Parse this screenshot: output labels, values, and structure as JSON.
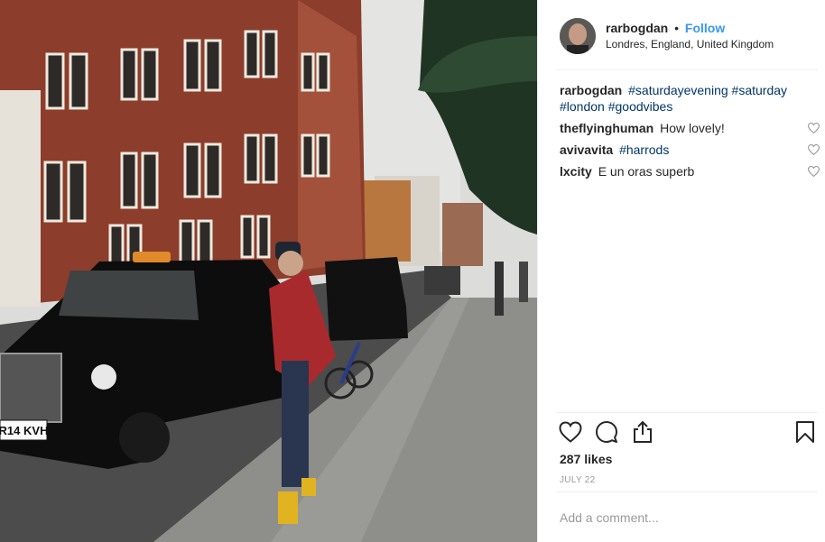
{
  "post": {
    "username": "rarbogdan",
    "separator": "•",
    "follow_label": "Follow",
    "location": "Londres, England, United Kingdom"
  },
  "caption": {
    "user": "rarbogdan",
    "tags": [
      "#saturdayevening",
      "#saturday",
      "#london",
      "#goodvibes"
    ]
  },
  "comments": [
    {
      "user": "theflyinghuman",
      "text": "How lovely!"
    },
    {
      "user": "avivavita",
      "text": "#harrods"
    },
    {
      "user": "lxcity",
      "text": "E un oras superb"
    }
  ],
  "actions": {
    "icons": [
      "heart-icon",
      "comment-icon",
      "share-icon",
      "bookmark-icon"
    ]
  },
  "likes": "287 likes",
  "date": "JULY 22",
  "add_comment_placeholder": "Add a comment...",
  "photo": {
    "taxi_plate": "R14 KVH"
  },
  "colors": {
    "link": "#3897f0",
    "hashtag": "#003569",
    "text": "#262626",
    "muted": "#999999"
  }
}
